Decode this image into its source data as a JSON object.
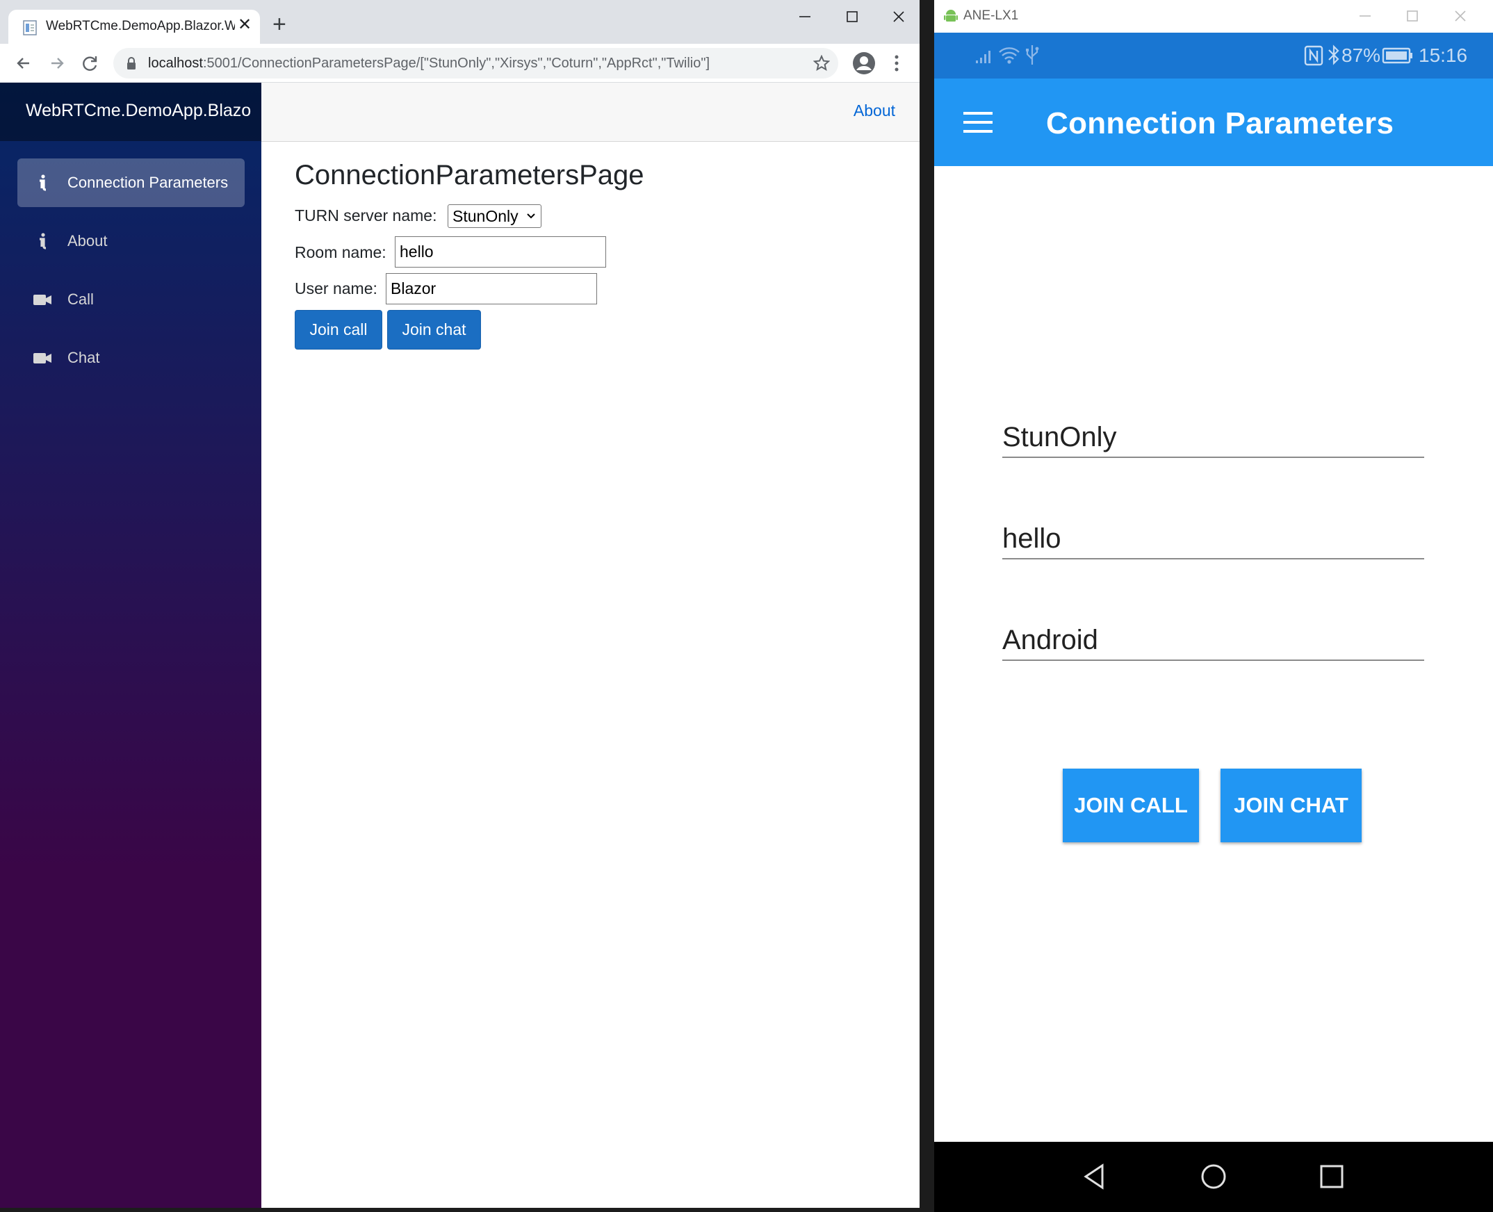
{
  "browser": {
    "tab_title": "WebRTCme.DemoApp.Blazor.Wa",
    "url_host": "localhost",
    "url_path": ":5001/ConnectionParametersPage/[\"StunOnly\",\"Xirsys\",\"Coturn\",\"AppRct\",\"Twilio\"]",
    "icons": [
      "back-arrow-icon",
      "forward-arrow-icon",
      "reload-icon",
      "lock-icon",
      "star-icon",
      "profile-icon",
      "kebab-menu-icon",
      "minimize-icon",
      "maximize-icon",
      "close-icon"
    ]
  },
  "app": {
    "brand": "WebRTCme.DemoApp.Blazo",
    "top_about": "About",
    "nav": [
      {
        "label": "Connection Parameters",
        "icon": "info-icon",
        "active": true
      },
      {
        "label": "About",
        "icon": "info-icon",
        "active": false
      },
      {
        "label": "Call",
        "icon": "video-camera-icon",
        "active": false
      },
      {
        "label": "Chat",
        "icon": "video-camera-icon",
        "active": false
      }
    ],
    "page_title": "ConnectionParametersPage",
    "turn_label": "TURN server name:",
    "turn_value": "StunOnly",
    "room_label": "Room name:",
    "room_value": "hello",
    "user_label": "User name:",
    "user_value": "Blazor",
    "join_call": "Join call",
    "join_chat": "Join chat",
    "colors": {
      "sidebar_top": "#052767",
      "sidebar_bottom": "#3a0647",
      "button": "#1b6ec2",
      "link": "#0366d6"
    }
  },
  "emulator": {
    "window_title": "ANE-LX1",
    "status": {
      "battery": "87%",
      "time": "15:16"
    },
    "app_title": "Connection Parameters",
    "turn_value": "StunOnly",
    "room_value": "hello",
    "user_value": "Android",
    "join_call": "JOIN CALL",
    "join_chat": "JOIN CHAT",
    "colors": {
      "appbar": "#2196f3",
      "statusbar": "#1976d2"
    }
  }
}
